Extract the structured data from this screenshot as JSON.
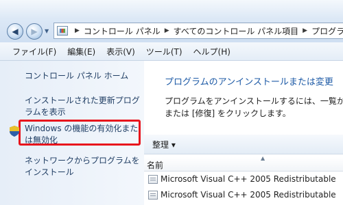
{
  "navigation": {
    "back_icon": "back-arrow-icon",
    "forward_icon": "forward-arrow-icon",
    "address_icon": "control-panel-icon",
    "breadcrumbs": [
      "コントロール パネル",
      "すべてのコントロール パネル項目",
      "プログラ"
    ]
  },
  "menu": {
    "items": [
      "ファイル(F)",
      "編集(E)",
      "表示(V)",
      "ツール(T)",
      "ヘルプ(H)"
    ]
  },
  "sidebar": {
    "home": "コントロール パネル ホーム",
    "installed_updates": "インストールされた更新プログラムを表示",
    "windows_features": "Windows の機能の有効化または無効化",
    "network_install": "ネットワークからプログラムをインストール",
    "highlight_color": "#e8121b"
  },
  "main": {
    "title": "プログラムのアンインストールまたは変更",
    "description_line1": "プログラムをアンインストールするには、一覧か",
    "description_line2": "または [修復] をクリックします。"
  },
  "toolbar": {
    "organize_label": "整理 ▾"
  },
  "list": {
    "column_name": "名前",
    "rows": [
      {
        "name": "Microsoft Visual C++ 2005 Redistributable"
      },
      {
        "name": "Microsoft Visual C++ 2005 Redistributable"
      }
    ]
  }
}
